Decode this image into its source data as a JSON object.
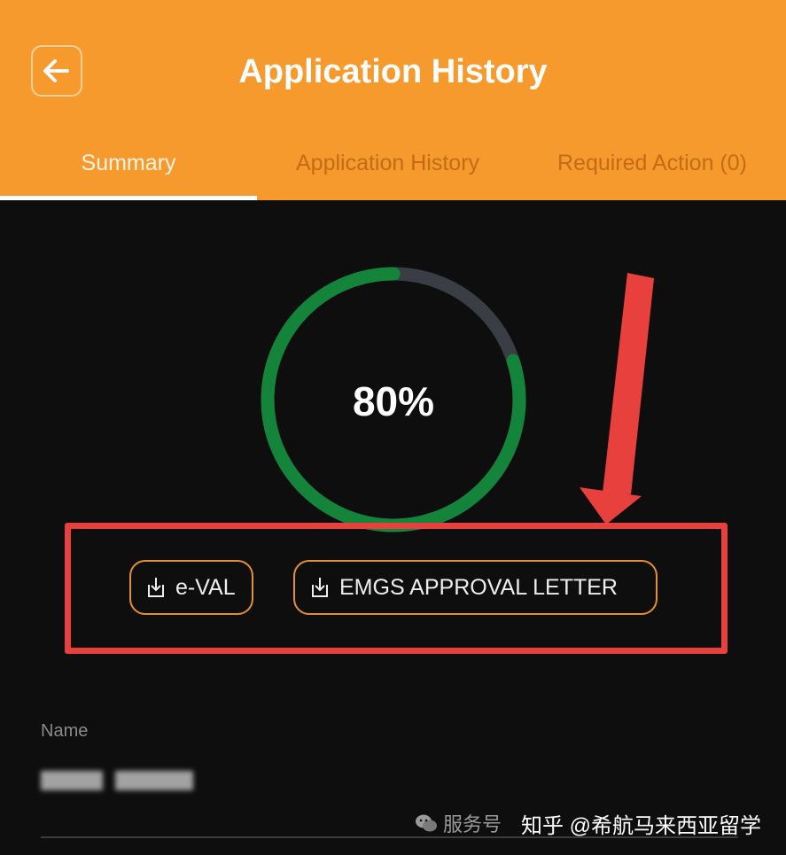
{
  "header": {
    "title": "Application History",
    "back_icon": "arrow-left-icon"
  },
  "tabs": [
    {
      "label": "Summary",
      "active": true
    },
    {
      "label": "Application History",
      "active": false
    },
    {
      "label": "Required Action (0)",
      "active": false
    }
  ],
  "progress": {
    "percent_label": "80%",
    "value": 0.8,
    "fill_color": "#13843a",
    "track_color": "#3a3d44"
  },
  "documents": [
    {
      "label": "e-VAL",
      "icon": "download-icon"
    },
    {
      "label": "EMGS APPROVAL LETTER",
      "icon": "download-icon"
    }
  ],
  "details": {
    "name_label": "Name"
  },
  "annotation": {
    "box_color": "#e8403d",
    "arrow_color": "#e8403d"
  },
  "watermark": {
    "service_text": "服务号",
    "main_text": "知乎 @希航马来西亚留学"
  },
  "colors": {
    "brand_orange": "#f69a2e",
    "button_border": "#e39033",
    "background": "#0e0e0e"
  }
}
